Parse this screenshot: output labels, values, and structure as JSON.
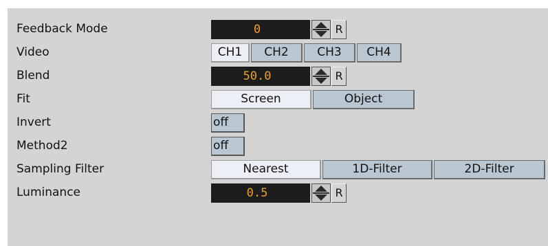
{
  "rows": {
    "feedback_mode": {
      "label": "Feedback Mode",
      "value": "0",
      "reset": "R"
    },
    "video": {
      "label": "Video",
      "options": [
        "CH1",
        "CH2",
        "CH3",
        "CH4"
      ],
      "selected": "CH1"
    },
    "blend": {
      "label": "Blend",
      "value": "50.0",
      "reset": "R"
    },
    "fit": {
      "label": "Fit",
      "options": [
        "Screen",
        "Object"
      ],
      "selected": "Screen"
    },
    "invert": {
      "label": "Invert",
      "value": "off"
    },
    "method2": {
      "label": "Method2",
      "value": "off"
    },
    "sampling_filter": {
      "label": "Sampling Filter",
      "options": [
        "Nearest",
        "1D-Filter",
        "2D-Filter"
      ],
      "selected": "Nearest"
    },
    "luminance": {
      "label": "Luminance",
      "value": "0.5",
      "reset": "R"
    }
  },
  "colors": {
    "panel": "#d4d4d4",
    "field_bg": "#1c1c1c",
    "field_text": "#f0a020",
    "button": "#b9c7d3",
    "button_active": "#ecf0f6"
  }
}
